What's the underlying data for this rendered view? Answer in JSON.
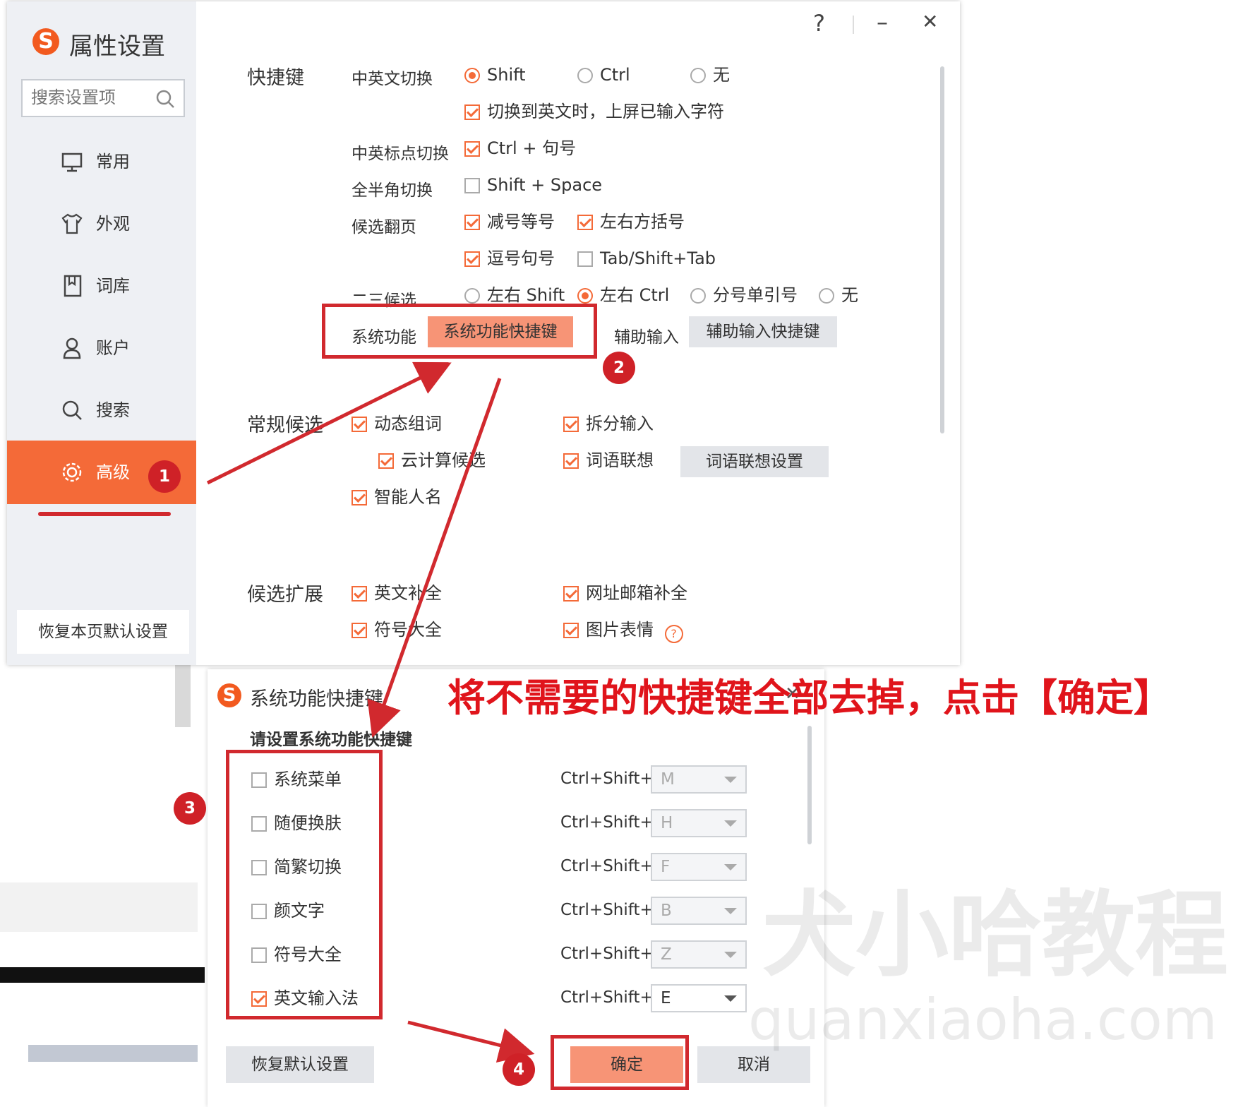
{
  "colors": {
    "accent": "#f46a38",
    "annotation": "#d1292e",
    "button_grey": "#e3e5e9",
    "confirm": "#f79476"
  },
  "main_window": {
    "title": "属性设置",
    "search_placeholder": "搜索设置项",
    "help": "?",
    "minimize": "–",
    "close": "✕",
    "nav": [
      {
        "label": "常用",
        "icon": "monitor-icon"
      },
      {
        "label": "外观",
        "icon": "shirt-icon"
      },
      {
        "label": "词库",
        "icon": "book-icon"
      },
      {
        "label": "账户",
        "icon": "user-icon"
      },
      {
        "label": "搜索",
        "icon": "search-icon"
      },
      {
        "label": "高级",
        "icon": "gear-icon",
        "active": true
      }
    ],
    "restore_page": "恢复本页默认设置",
    "shortcuts": {
      "section": "快捷键",
      "cn_en_switch": {
        "label": "中英文切换",
        "options": [
          "Shift",
          "Ctrl",
          "无"
        ],
        "selected": "Shift"
      },
      "commit_on_switch": {
        "label": "切换到英文时，上屏已输入字符",
        "checked": true
      },
      "punct_switch": {
        "label": "中英标点切换",
        "option": "Ctrl + 句号",
        "checked": true
      },
      "width_switch": {
        "label": "全半角切换",
        "option": "Shift + Space",
        "checked": false
      },
      "page_turn": {
        "label": "候选翻页",
        "options": [
          {
            "label": "减号等号",
            "checked": true
          },
          {
            "label": "左右方括号",
            "checked": true
          },
          {
            "label": "逗号句号",
            "checked": true
          },
          {
            "label": "Tab/Shift+Tab",
            "checked": false
          }
        ]
      },
      "second_third": {
        "label": "二三候选",
        "options": [
          "左右 Shift",
          "左右 Ctrl",
          "分号单引号",
          "无"
        ],
        "selected": "左右 Ctrl"
      },
      "system_func": {
        "label": "系统功能",
        "button": "系统功能快捷键"
      },
      "assist_input": {
        "label": "辅助输入",
        "button": "辅助输入快捷键"
      }
    },
    "regular_candidates": {
      "section": "常规候选",
      "options": [
        {
          "label": "动态组词",
          "checked": true
        },
        {
          "label": "拆分输入",
          "checked": true
        },
        {
          "label": "云计算候选",
          "checked": true
        },
        {
          "label": "词语联想",
          "checked": true
        },
        {
          "label": "智能人名",
          "checked": true
        }
      ],
      "assoc_button": "词语联想设置"
    },
    "candidate_ext": {
      "section": "候选扩展",
      "options": [
        {
          "label": "英文补全",
          "checked": true
        },
        {
          "label": "网址邮箱补全",
          "checked": true
        },
        {
          "label": "符号大全",
          "checked": true
        },
        {
          "label": "图片表情",
          "checked": true
        }
      ]
    }
  },
  "dialog": {
    "title": "系统功能快捷键",
    "close": "✕",
    "heading": "请设置系统功能快捷键",
    "prefix": "Ctrl+Shift+",
    "items": [
      {
        "label": "系统菜单",
        "checked": false,
        "key": "M"
      },
      {
        "label": "随便换肤",
        "checked": false,
        "key": "H"
      },
      {
        "label": "简繁切换",
        "checked": false,
        "key": "F"
      },
      {
        "label": "颜文字",
        "checked": false,
        "key": "B"
      },
      {
        "label": "符号大全",
        "checked": false,
        "key": "Z"
      },
      {
        "label": "英文输入法",
        "checked": true,
        "key": "E"
      }
    ],
    "restore": "恢复默认设置",
    "ok": "确定",
    "cancel": "取消"
  },
  "annotations": {
    "instruction": "将不需要的快捷键全部去掉，点击【确定】",
    "badges": [
      "1",
      "2",
      "3",
      "4"
    ]
  },
  "watermark": {
    "line1": "犬小哈教程",
    "line2": "quanxiaoha.com"
  }
}
